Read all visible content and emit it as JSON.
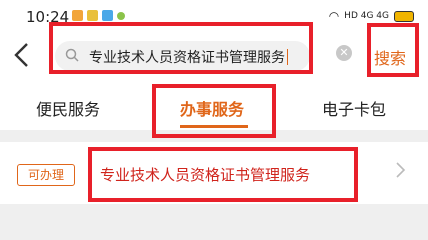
{
  "status_bar": {
    "time": "10:24",
    "signal_text": "HD 4G 4G"
  },
  "header": {
    "back_icon": "back-arrow-icon",
    "search_value": "专业技术人员资格证书管理服务",
    "search_button_label": "搜索"
  },
  "tabs": [
    {
      "label": "便民服务",
      "active": false
    },
    {
      "label": "办事服务",
      "active": true
    },
    {
      "label": "电子卡包",
      "active": false
    }
  ],
  "result": {
    "badge": "可办理",
    "title": "专业技术人员资格证书管理服务"
  },
  "colors": {
    "accent": "#e0661a",
    "highlight": "#e8202a",
    "result_text": "#d0241c"
  }
}
